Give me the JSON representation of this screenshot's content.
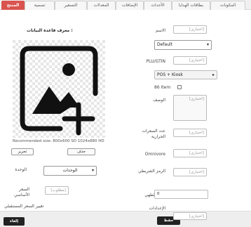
{
  "tabs": [
    {
      "label": "المكونات"
    },
    {
      "label": "بطاقات الهدايا"
    },
    {
      "label": "الأحداث"
    },
    {
      "label": "الإضافات"
    },
    {
      "label": "المعدلات"
    },
    {
      "label": "التسعير"
    },
    {
      "label": "تسمية"
    },
    {
      "label": "المنتج"
    }
  ],
  "form": {
    "name_label": "الاسم",
    "name_placeholder": "[اختياري]",
    "category_label": "الفئة",
    "category_value": "Default",
    "plu_label": "PLU/GTIN",
    "plu_placeholder": "[اختياري]",
    "visibility_label": "الرؤية",
    "visibility_value": "POS + Kiosk",
    "item86_label": "86 Item",
    "description_label": "الوصف",
    "description_placeholder": "[اختياري]",
    "calories_label": "عدد السعرات الحرارية",
    "calories_placeholder": "[اختياري]",
    "omnivore_label": "Omnivore",
    "omnivore_placeholder": "[اختياري]",
    "barcode_label": "الرمز الشريطي",
    "barcode_placeholder": "[اختياري]",
    "cooking_time_label": "وقت الطهي",
    "cooking_time_value": "0",
    "settings_label": "الإعدادات",
    "settings_placeholder": "[اختياري]"
  },
  "left": {
    "db_id_label": "معرف قاعدة البيانات :",
    "recommended_size": "Recommended size: 800x600 SD 1024x880 HD",
    "delete_label": "حذف",
    "edit_label": "تحرير",
    "unit_label": "الوحدة",
    "unit_value": "الوحدات",
    "base_price_label": "السعر الأساسي",
    "base_price_placeholder": "[مطلوب]",
    "future_price_label": "تغيير السعر المستقبلي"
  },
  "footer": {
    "cancel_label": "إلغاء",
    "save_label": "حفظ"
  },
  "colors": {
    "active_tab": "#d9534f",
    "footer_button": "#222222"
  }
}
